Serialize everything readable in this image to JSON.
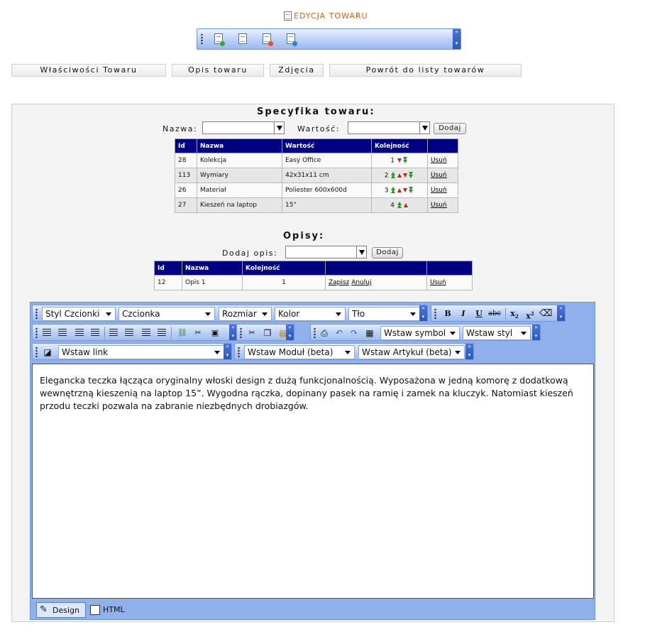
{
  "title": "EDYCJA TOWARU",
  "tabs": [
    "Właściwości Towaru",
    "Opis towaru",
    "Zdjęcia",
    "Powrót do listy towarów"
  ],
  "spec": {
    "heading": "Specyfika towaru:",
    "name_label": "Nazwa:",
    "value_label": "Wartość:",
    "add_button": "Dodaj",
    "columns": [
      "Id",
      "Nazwa",
      "Wartość",
      "Kolejność",
      ""
    ],
    "rows": [
      {
        "id": "28",
        "name": "Kolekcja",
        "value": "Easy Office",
        "order": "1",
        "action": "Usuń"
      },
      {
        "id": "113",
        "name": "Wymiary",
        "value": "42x31x11 cm",
        "order": "2",
        "action": "Usuń"
      },
      {
        "id": "26",
        "name": "Materiał",
        "value": "Poliester 600x600d",
        "order": "3",
        "action": "Usuń"
      },
      {
        "id": "27",
        "name": "Kieszeń na laptop",
        "value": "15\"",
        "order": "4",
        "action": "Usuń"
      }
    ]
  },
  "desc": {
    "heading": "Opisy:",
    "add_label": "Dodaj opis:",
    "add_button": "Dodaj",
    "columns": [
      "Id",
      "Nazwa",
      "Kolejność",
      "",
      ""
    ],
    "rows": [
      {
        "id": "12",
        "name": "Opis 1",
        "order": "1",
        "save": "Zapisz",
        "cancel": "Anuluj",
        "action": "Usuń"
      }
    ]
  },
  "editor": {
    "font_style": "Styl Czcionki",
    "font": "Czcionka",
    "size": "Rozmiar",
    "color": "Kolor",
    "background": "Tło",
    "insert_symbol": "Wstaw symbol",
    "insert_style": "Wstaw styl",
    "insert_link": "Wstaw link",
    "insert_module": "Wstaw Moduł (beta)",
    "insert_article": "Wstaw Artykuł (beta)",
    "content": "Elegancka teczka łącząca oryginalny włoski design z dużą funkcjonalnością. Wyposażona w jedną komorę z dodatkową wewnętrzną kieszenią na laptop 15”. Wygodna rączka, dopinany pasek na ramię i zamek na kluczyk. Natomiast kieszeń przodu teczki pozwala na zabranie niezbędnych drobiazgów.",
    "tab_design": "Design",
    "tab_html": "HTML"
  },
  "colors": {
    "title": "#e85a0a",
    "table_header": "#000080",
    "toolbar": "#b6cdf5"
  }
}
